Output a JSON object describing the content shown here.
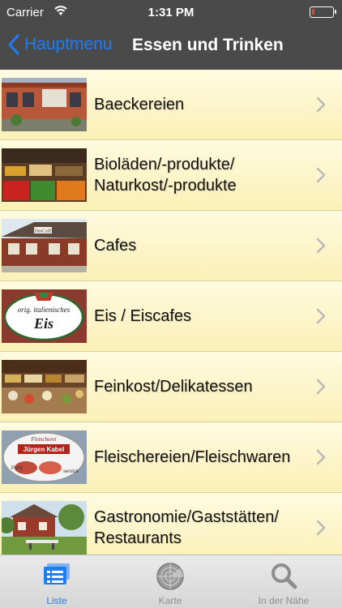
{
  "status": {
    "carrier": "Carrier",
    "time": "1:31 PM"
  },
  "nav": {
    "back_label": "Hauptmenu",
    "title": "Essen und Trinken"
  },
  "items": [
    {
      "label": "Baeckereien"
    },
    {
      "label": "Bioläden/-produkte/ Naturkost/-produkte"
    },
    {
      "label": "Cafes"
    },
    {
      "label": "Eis / Eiscafes"
    },
    {
      "label": "Feinkost/Delikatessen"
    },
    {
      "label": "Fleischereien/Fleischwaren"
    },
    {
      "label": "Gastronomie/Gaststätten/ Restaurants"
    }
  ],
  "thumbs": {
    "eis_sign_top": "orig. italienisches",
    "eis_sign_word": "Eis",
    "cafe_sign": "DasCafé",
    "fleisch_top": "Fleischerei",
    "fleisch_name": "Jürgen Kabel",
    "fleisch_side_left": "Party",
    "fleisch_side_right": "service"
  },
  "tabs": [
    {
      "label": "Liste",
      "icon": "list-icon",
      "active": true
    },
    {
      "label": "Karte",
      "icon": "radar-icon",
      "active": false
    },
    {
      "label": "In der Nähe",
      "icon": "search-icon",
      "active": false
    }
  ]
}
